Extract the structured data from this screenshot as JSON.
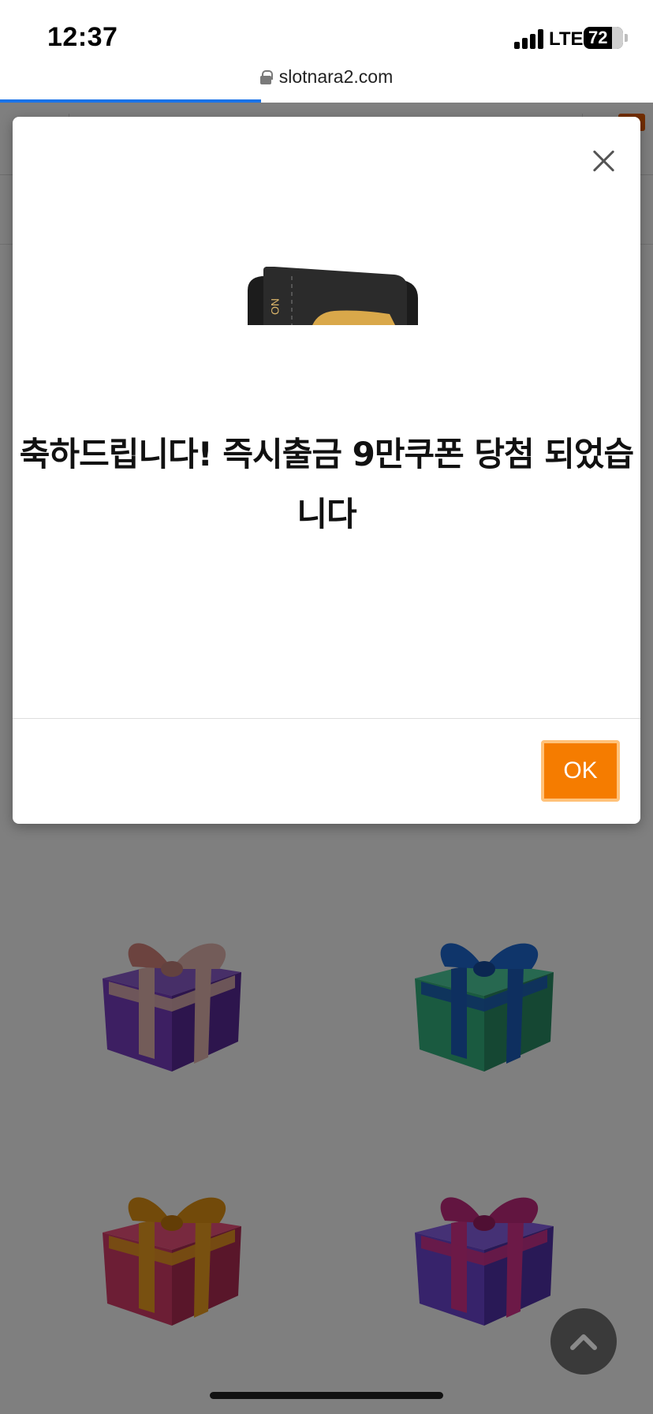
{
  "status_bar": {
    "time": "12:37",
    "network": "LTE",
    "battery": "72"
  },
  "browser": {
    "url": "slotnara2.com",
    "load_progress": 0.4
  },
  "dialog": {
    "message": "축하드립니다! 즉시출금 9만쿠폰 당첨 되었습니다",
    "ok_label": "OK"
  },
  "colors": {
    "ok_button": "#f57c00",
    "progress": "#1a73e8",
    "overlay": "rgba(0,0,0,0.5)"
  },
  "icons": [
    "lock-icon",
    "close-icon",
    "coupon-ticket-image",
    "gift-box-icon",
    "chevron-up-icon"
  ]
}
